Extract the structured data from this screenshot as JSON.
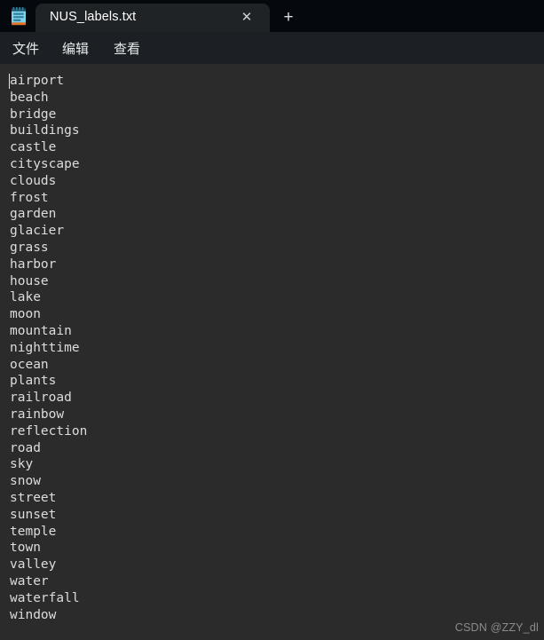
{
  "window": {
    "app_icon_name": "notepad-icon",
    "background_color": "#2b2b2b",
    "titlebar_color": "#05080d",
    "menubar_color": "#1c2024",
    "tab_color": "#1f2326",
    "text_color": "#dcdcdc"
  },
  "tabbar": {
    "tab_title": "NUS_labels.txt",
    "close_label": "✕",
    "new_tab_label": "+"
  },
  "menubar": {
    "items": [
      {
        "label": "文件"
      },
      {
        "label": "编辑"
      },
      {
        "label": "查看"
      }
    ]
  },
  "editor": {
    "content": "airport\nbeach\nbridge\nbuildings\ncastle\ncityscape\nclouds\nfrost\ngarden\nglacier\ngrass\nharbor\nhouse\nlake\nmoon\nmountain\nnighttime\nocean\nplants\nrailroad\nrainbow\nreflection\nroad\nsky\nsnow\nstreet\nsunset\ntemple\ntown\nvalley\nwater\nwaterfall\nwindow",
    "lines": [
      "airport",
      "beach",
      "bridge",
      "buildings",
      "castle",
      "cityscape",
      "clouds",
      "frost",
      "garden",
      "glacier",
      "grass",
      "harbor",
      "house",
      "lake",
      "moon",
      "mountain",
      "nighttime",
      "ocean",
      "plants",
      "railroad",
      "rainbow",
      "reflection",
      "road",
      "sky",
      "snow",
      "street",
      "sunset",
      "temple",
      "town",
      "valley",
      "water",
      "waterfall",
      "window"
    ]
  },
  "watermark": {
    "text": "CSDN @ZZY_dl"
  }
}
